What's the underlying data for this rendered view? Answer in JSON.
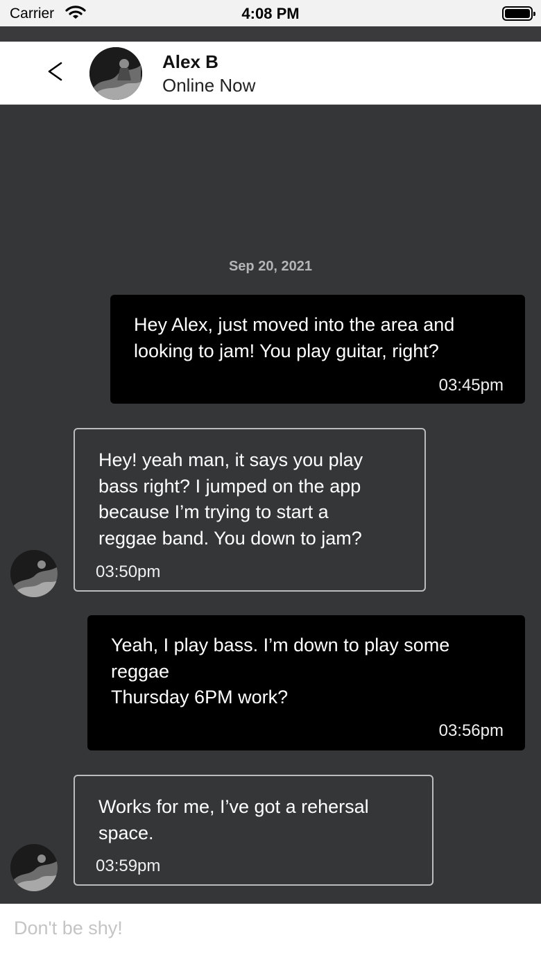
{
  "status_bar": {
    "carrier": "Carrier",
    "time": "4:08 PM",
    "wifi_icon": "wifi-icon",
    "battery_icon": "battery-icon"
  },
  "header": {
    "back_icon": "chevron-left-icon",
    "back_label": "<",
    "contact_name": "Alex B",
    "contact_status": "Online Now"
  },
  "conversation": {
    "date": "Sep 20, 2021",
    "messages": [
      {
        "direction": "outgoing",
        "text": "Hey Alex, just moved into the area and\nlooking to jam!  You play guitar, right?",
        "time": "03:45pm"
      },
      {
        "direction": "incoming",
        "text": "Hey! yeah man, it says you play\nbass right? I jumped on the app\nbecause I’m trying to start a\nreggae band. You down to jam?",
        "time": "03:50pm"
      },
      {
        "direction": "outgoing",
        "text": "Yeah, I play bass.  I’m down to play some\nreggae\nThursday 6PM work?",
        "time": "03:56pm"
      },
      {
        "direction": "incoming",
        "text": "Works for me, I’ve got a rehersal\nspace.",
        "time": "03:59pm"
      }
    ]
  },
  "composer": {
    "placeholder": "Don't be shy!"
  },
  "colors": {
    "background": "#353638",
    "outgoing_bubble": "#000000",
    "incoming_border": "#bdbdbd",
    "date_text": "#b5b5b5"
  }
}
